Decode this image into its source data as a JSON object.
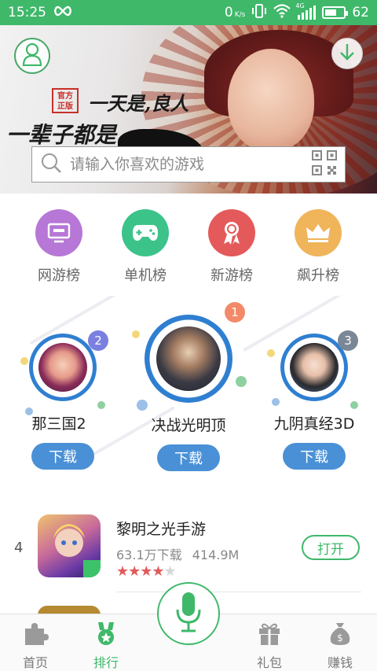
{
  "status_bar": {
    "time": "15:25",
    "infinity_icon": "infinity-icon",
    "speed": "0",
    "speed_unit": "K/s",
    "network": "4G",
    "battery": "62",
    "battery_level_percent": 62
  },
  "banner": {
    "badge_line1": "官方",
    "badge_line2": "正版",
    "slogan_line1": "一天是,良人",
    "slogan_line2": "一辈子都是",
    "search_placeholder": "请输入你喜欢的游戏",
    "avatar_icon": "user-icon",
    "download_icon": "arrow-down-icon",
    "qr_icon": "qr-code-icon"
  },
  "categories": [
    {
      "label": "网游榜",
      "color": "#b777d6",
      "icon": "tv-icon"
    },
    {
      "label": "单机榜",
      "color": "#3cc38a",
      "icon": "gamepad-icon"
    },
    {
      "label": "新游榜",
      "color": "#e45a5a",
      "icon": "ribbon-icon"
    },
    {
      "label": "飙升榜",
      "color": "#f0b45a",
      "icon": "crown-icon"
    }
  ],
  "podium": {
    "download_label": "下载",
    "items": [
      {
        "rank": "2",
        "name": "那三国2",
        "badge_color": "#7b7fe0"
      },
      {
        "rank": "1",
        "name": "决战光明顶",
        "badge_color": "#f28a6a"
      },
      {
        "rank": "3",
        "name": "九阴真经3D",
        "badge_color": "#7a8796"
      }
    ]
  },
  "list": [
    {
      "rank": "4",
      "title": "黎明之光手游",
      "downloads": "63.1万下载",
      "size": "414.9M",
      "rating_stars": 4,
      "action": "打开",
      "star_full": "★★★★",
      "star_empty": "★"
    }
  ],
  "bottom_nav": [
    {
      "label": "首页",
      "icon": "puzzle-icon",
      "active": false
    },
    {
      "label": "排行",
      "icon": "medal-icon",
      "active": true
    },
    {
      "label": "礼包",
      "icon": "gift-icon",
      "active": false
    },
    {
      "label": "赚钱",
      "icon": "money-bag-icon",
      "active": false
    }
  ],
  "voice_icon": "microphone-icon",
  "colors": {
    "primary_green": "#3fb86a",
    "download_blue": "#4a90d6"
  }
}
